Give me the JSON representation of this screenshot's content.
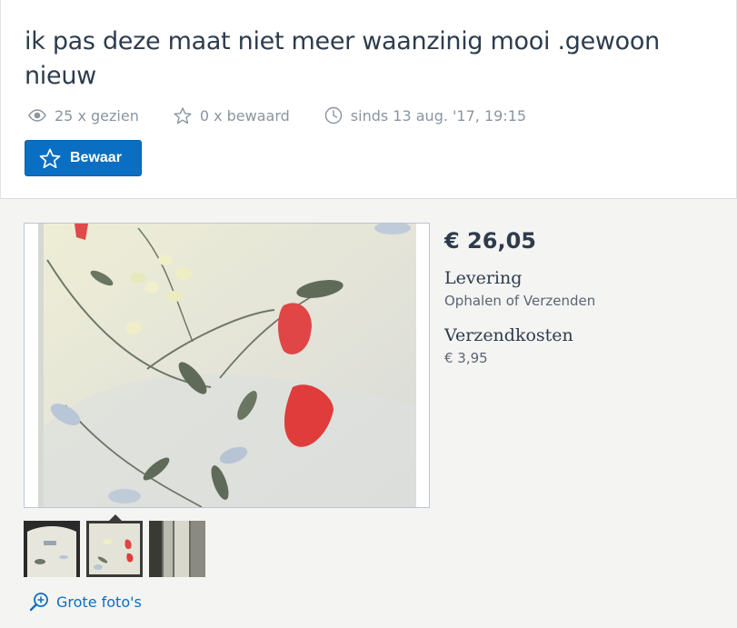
{
  "listing": {
    "title": "ik pas deze maat niet meer waanzinig mooi .gewoon nieuw",
    "views": "25 x gezien",
    "saved": "0 x bewaard",
    "since": "sinds 13 aug. '17, 19:15",
    "bewaar_label": "Bewaar"
  },
  "details": {
    "price": "€ 26,05",
    "levering_label": "Levering",
    "levering_value": "Ophalen of Verzenden",
    "verzendkosten_label": "Verzendkosten",
    "verzendkosten_value": "€ 3,95"
  },
  "gallery": {
    "grote_fotos_label": "Grote foto's",
    "thumbnail_count": 3,
    "active_thumbnail": 2
  },
  "icons": {
    "views": "eye-icon",
    "saved": "star-icon",
    "since": "clock-icon",
    "bewaar": "star-icon",
    "zoom": "zoom-in-icon"
  },
  "colors": {
    "accent": "#0a6fc2",
    "text": "#2d3c4d",
    "muted": "#8a95a0"
  }
}
